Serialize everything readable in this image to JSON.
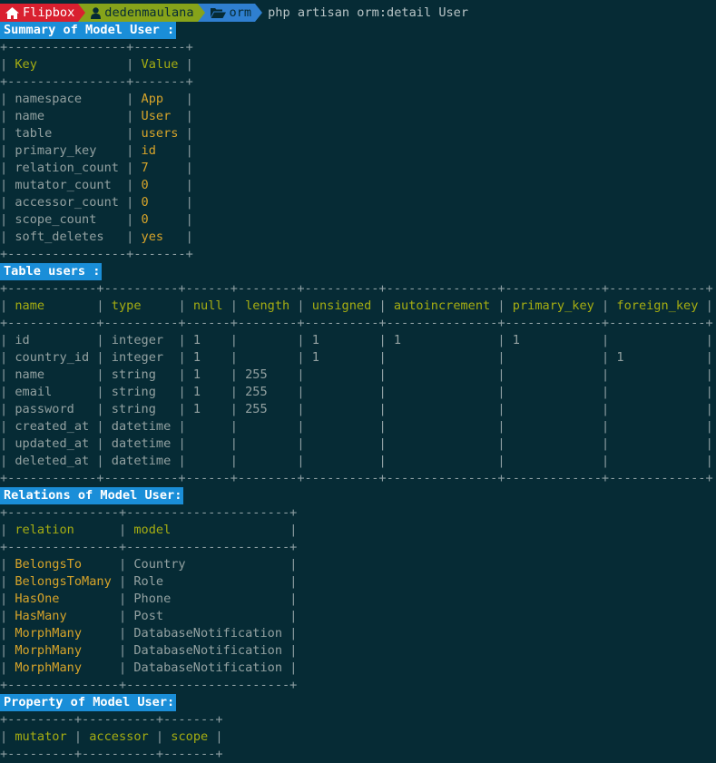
{
  "prompt": {
    "host": "Flipbox",
    "user": "dedenmaulana",
    "dir": "orm",
    "command": "php artisan orm:detail User",
    "colors": {
      "host_bg": "#d9202f",
      "user_bg": "#86a31a",
      "dir_bg": "#2f7fd0",
      "background": "#062b35"
    }
  },
  "sections": {
    "summary_title": "Summary of Model User :",
    "table_title": "Table users :",
    "relations_title": "Relations of Model User:",
    "property_title": "Property of Model User:"
  },
  "summary": {
    "columns": [
      "Key",
      "Value"
    ],
    "rows": [
      [
        "namespace",
        "App"
      ],
      [
        "name",
        "User"
      ],
      [
        "table",
        "users"
      ],
      [
        "primary_key",
        "id"
      ],
      [
        "relation_count",
        "7"
      ],
      [
        "mutator_count",
        "0"
      ],
      [
        "accessor_count",
        "0"
      ],
      [
        "scope_count",
        "0"
      ],
      [
        "soft_deletes",
        "yes"
      ]
    ]
  },
  "table": {
    "columns": [
      "name",
      "type",
      "null",
      "length",
      "unsigned",
      "autoincrement",
      "primary_key",
      "foreign_key"
    ],
    "rows": [
      [
        "id",
        "integer",
        "1",
        "",
        "1",
        "1",
        "1",
        ""
      ],
      [
        "country_id",
        "integer",
        "1",
        "",
        "1",
        "",
        "",
        "1"
      ],
      [
        "name",
        "string",
        "1",
        "255",
        "",
        "",
        "",
        ""
      ],
      [
        "email",
        "string",
        "1",
        "255",
        "",
        "",
        "",
        ""
      ],
      [
        "password",
        "string",
        "1",
        "255",
        "",
        "",
        "",
        ""
      ],
      [
        "created_at",
        "datetime",
        "",
        "",
        "",
        "",
        "",
        ""
      ],
      [
        "updated_at",
        "datetime",
        "",
        "",
        "",
        "",
        "",
        ""
      ],
      [
        "deleted_at",
        "datetime",
        "",
        "",
        "",
        "",
        "",
        ""
      ]
    ]
  },
  "relations": {
    "columns": [
      "relation",
      "model"
    ],
    "rows": [
      [
        "BelongsTo",
        "Country"
      ],
      [
        "BelongsToMany",
        "Role"
      ],
      [
        "HasOne",
        "Phone"
      ],
      [
        "HasMany",
        "Post"
      ],
      [
        "MorphMany",
        "DatabaseNotification"
      ],
      [
        "MorphMany",
        "DatabaseNotification"
      ],
      [
        "MorphMany",
        "DatabaseNotification"
      ]
    ]
  },
  "property": {
    "columns": [
      "mutator",
      "accessor",
      "scope"
    ]
  }
}
